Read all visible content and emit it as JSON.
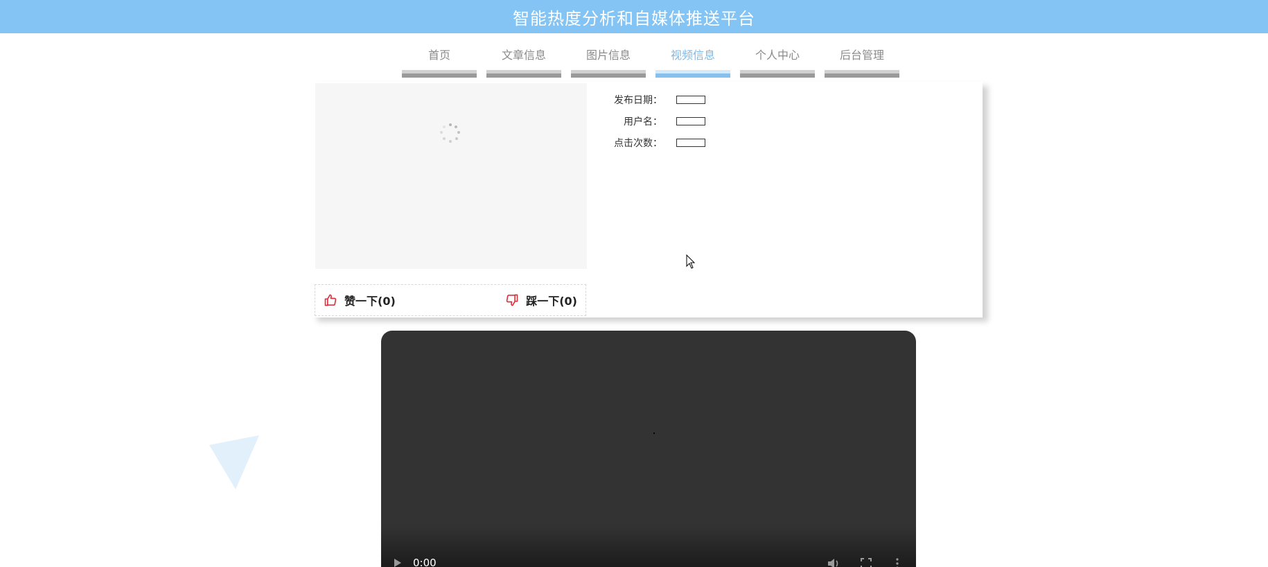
{
  "header": {
    "title": "智能热度分析和自媒体推送平台"
  },
  "nav": {
    "items": [
      {
        "label": "首页",
        "active": false
      },
      {
        "label": "文章信息",
        "active": false
      },
      {
        "label": "图片信息",
        "active": false
      },
      {
        "label": "视频信息",
        "active": true
      },
      {
        "label": "个人中心",
        "active": false
      },
      {
        "label": "后台管理",
        "active": false
      }
    ]
  },
  "detail": {
    "fields": [
      {
        "label": "发布日期：",
        "value": ""
      },
      {
        "label": "用户名：",
        "value": ""
      },
      {
        "label": "点击次数：",
        "value": ""
      }
    ],
    "like_label": "赞一下(0)",
    "dislike_label": "踩一下(0)"
  },
  "video_player": {
    "time": "0:00"
  },
  "icons": {
    "like": "thumbs-up-icon",
    "dislike": "thumbs-down-icon",
    "loading": "loading-spinner-icon",
    "play": "play-icon",
    "volume": "volume-icon",
    "fullscreen": "fullscreen-icon",
    "more": "more-vertical-icon"
  },
  "colors": {
    "header_bg": "#83c4f4",
    "nav_active": "#7fb8e6",
    "vote_icon": "#d9333f",
    "player_bg": "#333333"
  }
}
